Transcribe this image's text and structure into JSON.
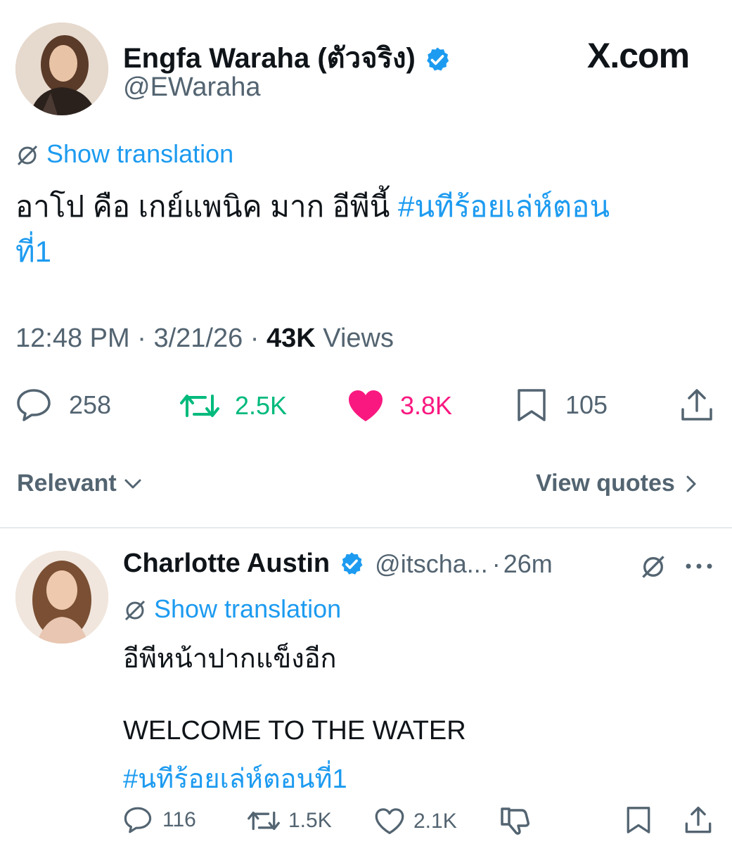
{
  "header": {
    "author_name": "Engfa Waraha (ตัวจริง)",
    "author_handle": "@EWaraha",
    "site_logo": "X.com"
  },
  "tweet": {
    "translate_label": "Show translation",
    "text": "อาโป คือ เกย์แพนิค มาก อีพีนี้ ",
    "hashtag_line1": "#นทีร้อยเล่ห์ตอน",
    "hashtag_line2": "ที่1",
    "time": "12:48 PM",
    "date": "3/21/26",
    "views_count": "43K",
    "views_label": "Views",
    "sep": "·"
  },
  "actions": {
    "replies": "258",
    "reposts": "2.5K",
    "likes": "3.8K",
    "bookmarks": "105"
  },
  "colors": {
    "accent": "#1d9bf0",
    "repost": "#00ba7c",
    "like": "#f91880",
    "muted": "#536471"
  },
  "sort": {
    "label": "Relevant",
    "view_quotes": "View quotes"
  },
  "reply": {
    "author_name": "Charlotte Austin",
    "author_handle": "@itscha...",
    "age": "26m",
    "translate_label": "Show translation",
    "line1": "อีพีหน้าปากแข็งอีก",
    "line2": "WELCOME TO THE WATER",
    "hashtag": "#นทีร้อยเล่ห์ตอนที่1",
    "replies": "116",
    "reposts": "1.5K",
    "likes": "2.1K"
  }
}
